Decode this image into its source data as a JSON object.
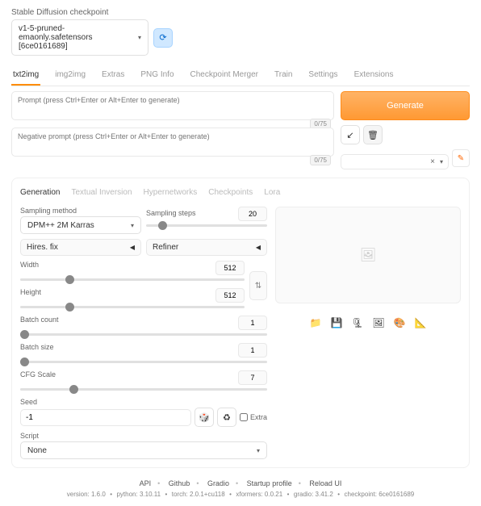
{
  "checkpoint": {
    "label": "Stable Diffusion checkpoint",
    "value": "v1-5-pruned-emaonly.safetensors [6ce0161689]"
  },
  "tabs": [
    "txt2img",
    "img2img",
    "Extras",
    "PNG Info",
    "Checkpoint Merger",
    "Train",
    "Settings",
    "Extensions"
  ],
  "prompt": {
    "placeholder": "Prompt (press Ctrl+Enter or Alt+Enter to generate)",
    "counter": "0/75"
  },
  "neg_prompt": {
    "placeholder": "Negative prompt (press Ctrl+Enter or Alt+Enter to generate)",
    "counter": "0/75"
  },
  "generate_label": "Generate",
  "subtabs": [
    "Generation",
    "Textual Inversion",
    "Hypernetworks",
    "Checkpoints",
    "Lora"
  ],
  "sampling": {
    "method_label": "Sampling method",
    "method_value": "DPM++ 2M Karras",
    "steps_label": "Sampling steps",
    "steps_value": "20"
  },
  "hires_label": "Hires. fix",
  "refiner_label": "Refiner",
  "width": {
    "label": "Width",
    "value": "512"
  },
  "height": {
    "label": "Height",
    "value": "512"
  },
  "batch_count": {
    "label": "Batch count",
    "value": "1"
  },
  "batch_size": {
    "label": "Batch size",
    "value": "1"
  },
  "cfg": {
    "label": "CFG Scale",
    "value": "7"
  },
  "seed": {
    "label": "Seed",
    "value": "-1",
    "extra_label": "Extra"
  },
  "script": {
    "label": "Script",
    "value": "None"
  },
  "footer": {
    "links": [
      "API",
      "Github",
      "Gradio",
      "Startup profile",
      "Reload UI"
    ],
    "version": "version: 1.6.0",
    "python": "python: 3.10.11",
    "torch": "torch: 2.0.1+cu118",
    "xformers": "xformers: 0.0.21",
    "gradio": "gradio: 3.41.2",
    "checkpoint": "checkpoint: 6ce0161689"
  }
}
